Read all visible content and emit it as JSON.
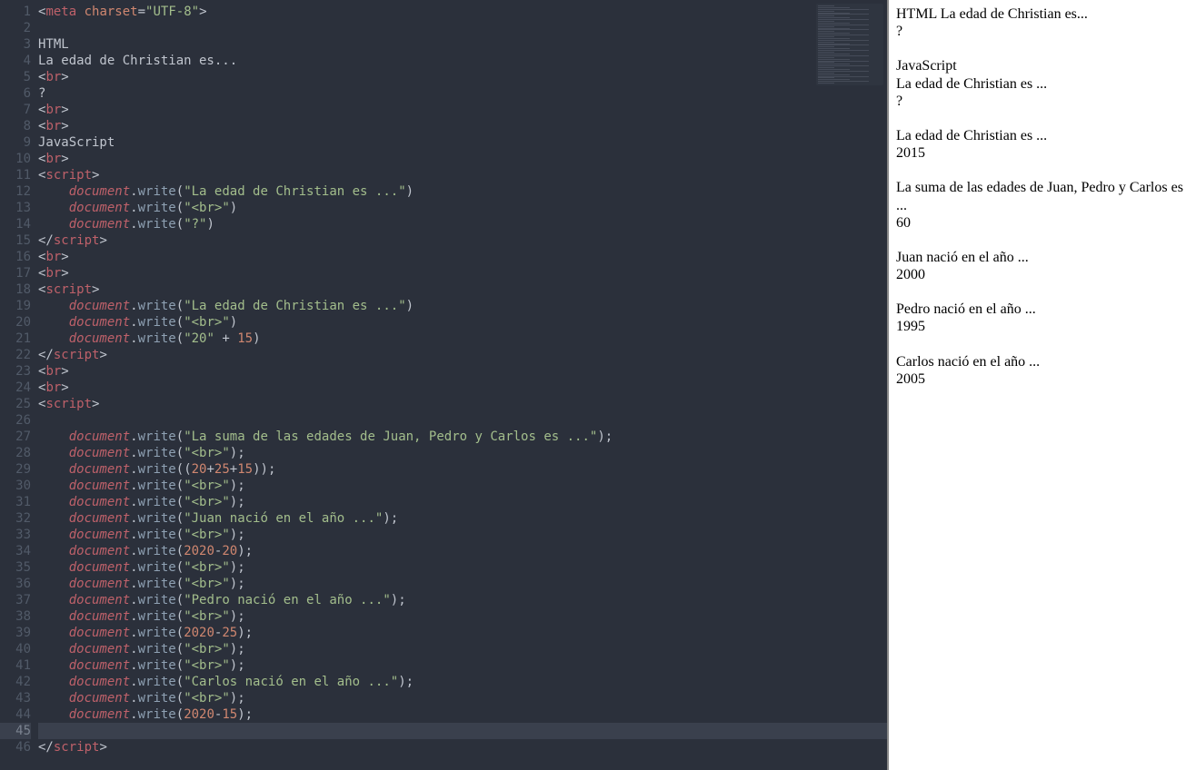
{
  "editor": {
    "line_count": 46,
    "active_line": 45,
    "lines": [
      {
        "n": 1,
        "t": "tag_open_attr",
        "tag": "meta",
        "attr": "charset",
        "val": "\"UTF-8\""
      },
      {
        "n": 2,
        "t": "blank"
      },
      {
        "n": 3,
        "t": "text",
        "val": "HTML"
      },
      {
        "n": 4,
        "t": "text",
        "val": "La edad de Christian es..."
      },
      {
        "n": 5,
        "t": "tag_self",
        "tag": "br"
      },
      {
        "n": 6,
        "t": "text",
        "val": "?"
      },
      {
        "n": 7,
        "t": "tag_self",
        "tag": "br"
      },
      {
        "n": 8,
        "t": "tag_self",
        "tag": "br"
      },
      {
        "n": 9,
        "t": "text",
        "val": "JavaScript"
      },
      {
        "n": 10,
        "t": "tag_self",
        "tag": "br"
      },
      {
        "n": 11,
        "t": "tag_open",
        "tag": "script"
      },
      {
        "n": 12,
        "t": "dw_str",
        "indent": "    ",
        "str": "\"La edad de Christian es ...\""
      },
      {
        "n": 13,
        "t": "dw_str",
        "indent": "    ",
        "str": "\"<br>\""
      },
      {
        "n": 14,
        "t": "dw_str",
        "indent": "    ",
        "str": "\"?\""
      },
      {
        "n": 15,
        "t": "tag_close",
        "tag": "script"
      },
      {
        "n": 16,
        "t": "tag_self",
        "tag": "br"
      },
      {
        "n": 17,
        "t": "tag_self",
        "tag": "br"
      },
      {
        "n": 18,
        "t": "tag_open",
        "tag": "script"
      },
      {
        "n": 19,
        "t": "dw_str",
        "indent": "    ",
        "str": "\"La edad de Christian es ...\""
      },
      {
        "n": 20,
        "t": "dw_str",
        "indent": "    ",
        "str": "\"<br>\""
      },
      {
        "n": 21,
        "t": "dw_concat",
        "indent": "    ",
        "left": "\"20\"",
        "right": "15"
      },
      {
        "n": 22,
        "t": "tag_close",
        "tag": "script"
      },
      {
        "n": 23,
        "t": "tag_self",
        "tag": "br"
      },
      {
        "n": 24,
        "t": "tag_self",
        "tag": "br"
      },
      {
        "n": 25,
        "t": "tag_open",
        "tag": "script"
      },
      {
        "n": 26,
        "t": "blank"
      },
      {
        "n": 27,
        "t": "dw_str_semi",
        "indent": "    ",
        "str": "\"La suma de las edades de Juan, Pedro y Carlos es ...\""
      },
      {
        "n": 28,
        "t": "dw_str_semi",
        "indent": "    ",
        "str": "\"<br>\""
      },
      {
        "n": 29,
        "t": "dw_expr_semi",
        "indent": "    ",
        "expr": [
          {
            "p": "("
          },
          {
            "n": "20"
          },
          {
            "p": "+"
          },
          {
            "n": "25"
          },
          {
            "p": "+"
          },
          {
            "n": "15"
          },
          {
            "p": ")"
          }
        ]
      },
      {
        "n": 30,
        "t": "dw_str_semi",
        "indent": "    ",
        "str": "\"<br>\""
      },
      {
        "n": 31,
        "t": "dw_str_semi",
        "indent": "    ",
        "str": "\"<br>\""
      },
      {
        "n": 32,
        "t": "dw_str_semi",
        "indent": "    ",
        "str": "\"Juan nació en el año ...\""
      },
      {
        "n": 33,
        "t": "dw_str_semi",
        "indent": "    ",
        "str": "\"<br>\""
      },
      {
        "n": 34,
        "t": "dw_expr_semi",
        "indent": "    ",
        "expr": [
          {
            "n": "2020"
          },
          {
            "p": "-"
          },
          {
            "n": "20"
          }
        ]
      },
      {
        "n": 35,
        "t": "dw_str_semi",
        "indent": "    ",
        "str": "\"<br>\""
      },
      {
        "n": 36,
        "t": "dw_str_semi",
        "indent": "    ",
        "str": "\"<br>\""
      },
      {
        "n": 37,
        "t": "dw_str_semi",
        "indent": "    ",
        "str": "\"Pedro nació en el año ...\""
      },
      {
        "n": 38,
        "t": "dw_str_semi",
        "indent": "    ",
        "str": "\"<br>\""
      },
      {
        "n": 39,
        "t": "dw_expr_semi",
        "indent": "    ",
        "expr": [
          {
            "n": "2020"
          },
          {
            "p": "-"
          },
          {
            "n": "25"
          }
        ]
      },
      {
        "n": 40,
        "t": "dw_str_semi",
        "indent": "    ",
        "str": "\"<br>\""
      },
      {
        "n": 41,
        "t": "dw_str_semi",
        "indent": "    ",
        "str": "\"<br>\""
      },
      {
        "n": 42,
        "t": "dw_str_semi",
        "indent": "    ",
        "str": "\"Carlos nació en el año ...\""
      },
      {
        "n": 43,
        "t": "dw_str_semi",
        "indent": "    ",
        "str": "\"<br>\""
      },
      {
        "n": 44,
        "t": "dw_expr_semi",
        "indent": "    ",
        "expr": [
          {
            "n": "2020"
          },
          {
            "p": "-"
          },
          {
            "n": "15"
          }
        ]
      },
      {
        "n": 45,
        "t": "blank",
        "active": true
      },
      {
        "n": 46,
        "t": "tag_close",
        "tag": "script"
      }
    ]
  },
  "preview": {
    "lines": [
      "HTML La edad de Christian es...",
      "?",
      "",
      "JavaScript",
      "La edad de Christian es ...",
      "?",
      "",
      "La edad de Christian es ...",
      "2015",
      "",
      "La suma de las edades de Juan, Pedro y Carlos es ...",
      "60",
      "",
      "Juan nació en el año ...",
      "2000",
      "",
      "Pedro nació en el año ...",
      "1995",
      "",
      "Carlos nació en el año ...",
      "2005"
    ]
  }
}
